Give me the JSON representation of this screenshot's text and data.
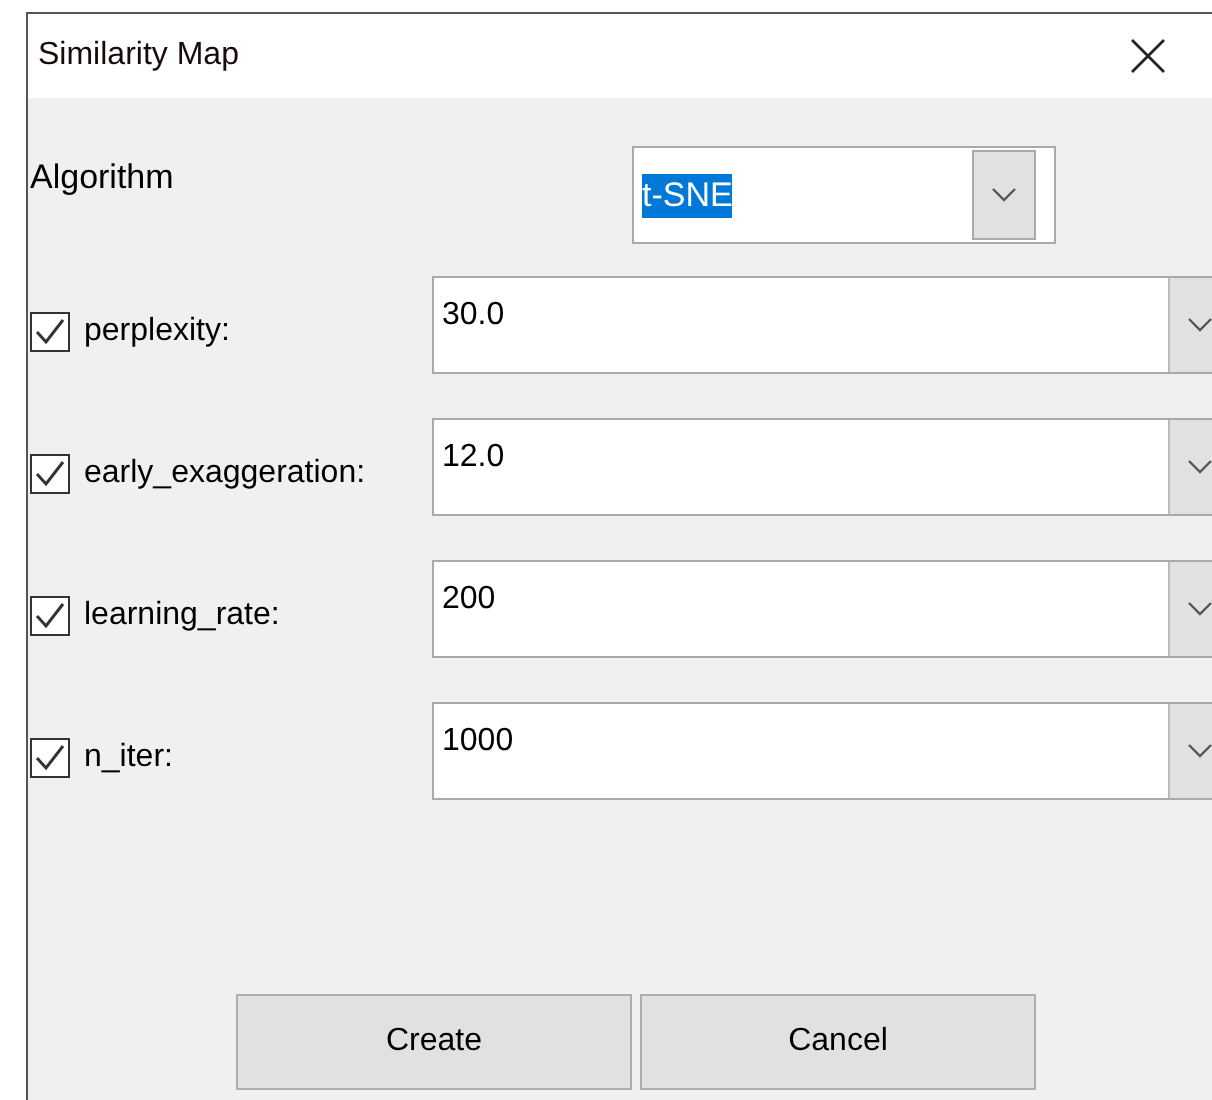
{
  "window": {
    "title": "Similarity Map"
  },
  "algorithm": {
    "label": "Algorithm",
    "value": "t-SNE",
    "highlighted": true
  },
  "parameters": [
    {
      "label": "perplexity:",
      "checked": true,
      "value": "30.0"
    },
    {
      "label": "early_exaggeration:",
      "checked": true,
      "value": "12.0"
    },
    {
      "label": "learning_rate:",
      "checked": true,
      "value": "200"
    },
    {
      "label": "n_iter:",
      "checked": true,
      "value": "1000"
    }
  ],
  "buttons": [
    "Create",
    "Cancel"
  ]
}
